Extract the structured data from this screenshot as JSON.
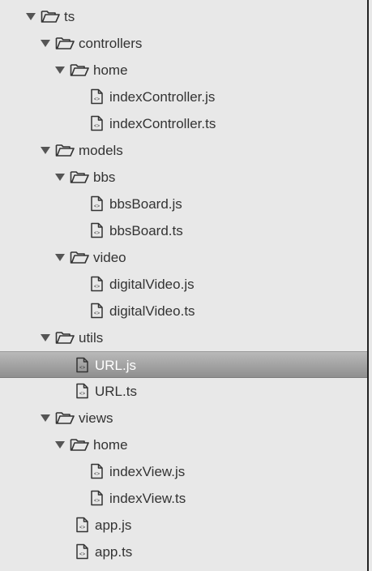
{
  "tree": {
    "items": [
      {
        "label": "ts",
        "type": "folder",
        "depth": 0
      },
      {
        "label": "controllers",
        "type": "folder",
        "depth": 1
      },
      {
        "label": "home",
        "type": "folder",
        "depth": 2
      },
      {
        "label": "indexController.js",
        "type": "file",
        "depth": 3
      },
      {
        "label": "indexController.ts",
        "type": "file",
        "depth": 3
      },
      {
        "label": "models",
        "type": "folder",
        "depth": 1
      },
      {
        "label": "bbs",
        "type": "folder",
        "depth": 2
      },
      {
        "label": "bbsBoard.js",
        "type": "file",
        "depth": 3
      },
      {
        "label": "bbsBoard.ts",
        "type": "file",
        "depth": 3
      },
      {
        "label": "video",
        "type": "folder",
        "depth": 2
      },
      {
        "label": "digitalVideo.js",
        "type": "file",
        "depth": 3
      },
      {
        "label": "digitalVideo.ts",
        "type": "file",
        "depth": 3
      },
      {
        "label": "utils",
        "type": "folder",
        "depth": 1
      },
      {
        "label": "URL.js",
        "type": "file",
        "depth": 2,
        "selected": true
      },
      {
        "label": "URL.ts",
        "type": "file",
        "depth": 2
      },
      {
        "label": "views",
        "type": "folder",
        "depth": 1
      },
      {
        "label": "home",
        "type": "folder",
        "depth": 2
      },
      {
        "label": "indexView.js",
        "type": "file",
        "depth": 3
      },
      {
        "label": "indexView.ts",
        "type": "file",
        "depth": 3
      },
      {
        "label": "app.js",
        "type": "file",
        "depth": 2
      },
      {
        "label": "app.ts",
        "type": "file",
        "depth": 2
      }
    ]
  },
  "icons": {
    "expand": "triangle-down-icon",
    "folder": "open-folder-icon",
    "file": "code-file-icon"
  }
}
